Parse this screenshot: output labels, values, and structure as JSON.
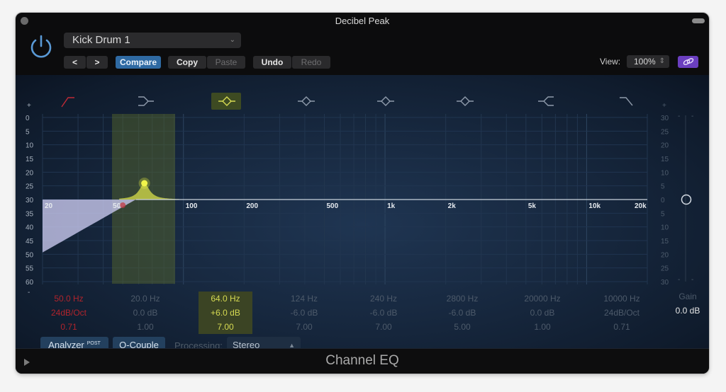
{
  "window": {
    "title": "Decibel Peak"
  },
  "header": {
    "preset": "Kick Drum 1",
    "prev_label": "<",
    "next_label": ">",
    "compare_label": "Compare",
    "copy_label": "Copy",
    "paste_label": "Paste",
    "undo_label": "Undo",
    "redo_label": "Redo",
    "view_label": "View:",
    "view_value": "100%",
    "icons": {
      "power": "power-icon",
      "link": "link-icon"
    }
  },
  "colors": {
    "accent_blue": "#2f6aa3",
    "link_purple": "#6b3fc0",
    "selected_band": "#d6da52",
    "low_cut_red": "#b0242c"
  },
  "graph": {
    "left_scale_top": "+",
    "left_scale_bottom": "-",
    "left_scale": [
      "0",
      "5",
      "10",
      "15",
      "20",
      "25",
      "30",
      "35",
      "40",
      "45",
      "50",
      "55",
      "60"
    ],
    "right_scale_top": "+",
    "right_scale_bottom": "-",
    "right_scale": [
      "30",
      "25",
      "20",
      "15",
      "10",
      "5",
      "0",
      "5",
      "10",
      "15",
      "20",
      "25",
      "30"
    ],
    "freq_labels": [
      {
        "label": "20",
        "hz": 20
      },
      {
        "label": "50",
        "hz": 50
      },
      {
        "label": "100",
        "hz": 100
      },
      {
        "label": "200",
        "hz": 200
      },
      {
        "label": "500",
        "hz": 500
      },
      {
        "label": "1k",
        "hz": 1000
      },
      {
        "label": "2k",
        "hz": 2000
      },
      {
        "label": "5k",
        "hz": 5000
      },
      {
        "label": "10k",
        "hz": 10000
      },
      {
        "label": "20k",
        "hz": 20000
      }
    ]
  },
  "bands": [
    {
      "name": "low-cut",
      "icon": "low-cut-icon",
      "freq": "50.0 Hz",
      "gain": "24dB/Oct",
      "q": "0.71",
      "state": "red"
    },
    {
      "name": "low-shelf",
      "icon": "low-shelf-icon",
      "freq": "20.0 Hz",
      "gain": "0.0 dB",
      "q": "1.00",
      "state": "off"
    },
    {
      "name": "bell-1",
      "icon": "bell-icon",
      "freq": "64.0 Hz",
      "gain": "+6.0 dB",
      "q": "7.00",
      "state": "selected"
    },
    {
      "name": "bell-2",
      "icon": "bell-icon",
      "freq": "124 Hz",
      "gain": "-6.0 dB",
      "q": "7.00",
      "state": "off"
    },
    {
      "name": "bell-3",
      "icon": "bell-icon",
      "freq": "240 Hz",
      "gain": "-6.0 dB",
      "q": "7.00",
      "state": "off"
    },
    {
      "name": "bell-4",
      "icon": "bell-icon",
      "freq": "2800 Hz",
      "gain": "-6.0 dB",
      "q": "5.00",
      "state": "off"
    },
    {
      "name": "high-shelf",
      "icon": "high-shelf-icon",
      "freq": "20000 Hz",
      "gain": "0.0 dB",
      "q": "1.00",
      "state": "off"
    },
    {
      "name": "high-cut",
      "icon": "high-cut-icon",
      "freq": "10000 Hz",
      "gain": "24dB/Oct",
      "q": "0.71",
      "state": "off"
    }
  ],
  "gain": {
    "label": "Gain",
    "value": "0.0 dB",
    "level_db": 0
  },
  "footer_controls": {
    "analyzer_label": "Analyzer",
    "analyzer_badge": "POST",
    "qcouple_label": "Q-Couple",
    "processing_label": "Processing:",
    "processing_value": "Stereo"
  },
  "footer": {
    "plugin_name": "Channel EQ"
  }
}
